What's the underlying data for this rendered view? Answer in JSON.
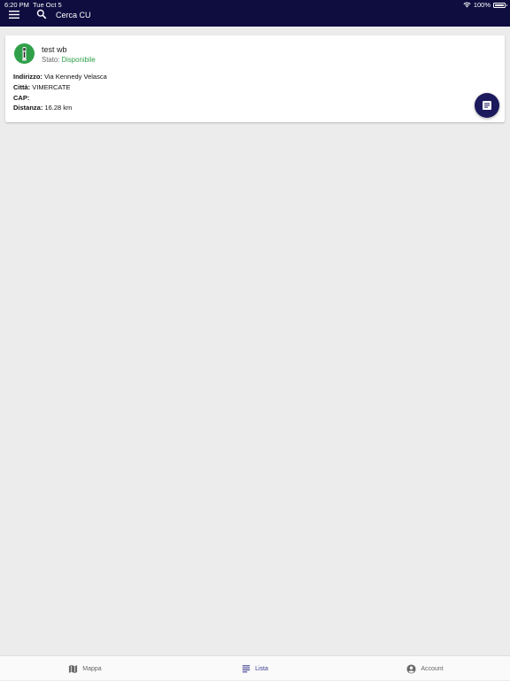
{
  "status_bar": {
    "time": "6:20 PM",
    "date": "Tue Oct 5",
    "battery": "100%"
  },
  "header": {
    "search_placeholder": "Cerca CU",
    "background_color": "#0f0c3f"
  },
  "card": {
    "title": "test wb",
    "status_label": "Stato:",
    "status_value": "Disponibile",
    "status_color": "#2fa049",
    "address_label": "Indirizzo:",
    "address_value": "Via Kennedy Velasca",
    "city_label": "Città:",
    "city_value": "VIMERCATE",
    "cap_label": "CAP:",
    "cap_value": "",
    "distance_label": "Distanza:",
    "distance_value": "16.28 km",
    "icon": "fuel-pump-icon",
    "fab_icon": "document-icon"
  },
  "bottom_nav": {
    "items": [
      {
        "label": "Mappa",
        "icon": "map-icon",
        "active": false
      },
      {
        "label": "Lista",
        "icon": "list-icon",
        "active": true
      },
      {
        "label": "Account",
        "icon": "account-icon",
        "active": false
      }
    ],
    "active_color": "#3b3b8f"
  }
}
